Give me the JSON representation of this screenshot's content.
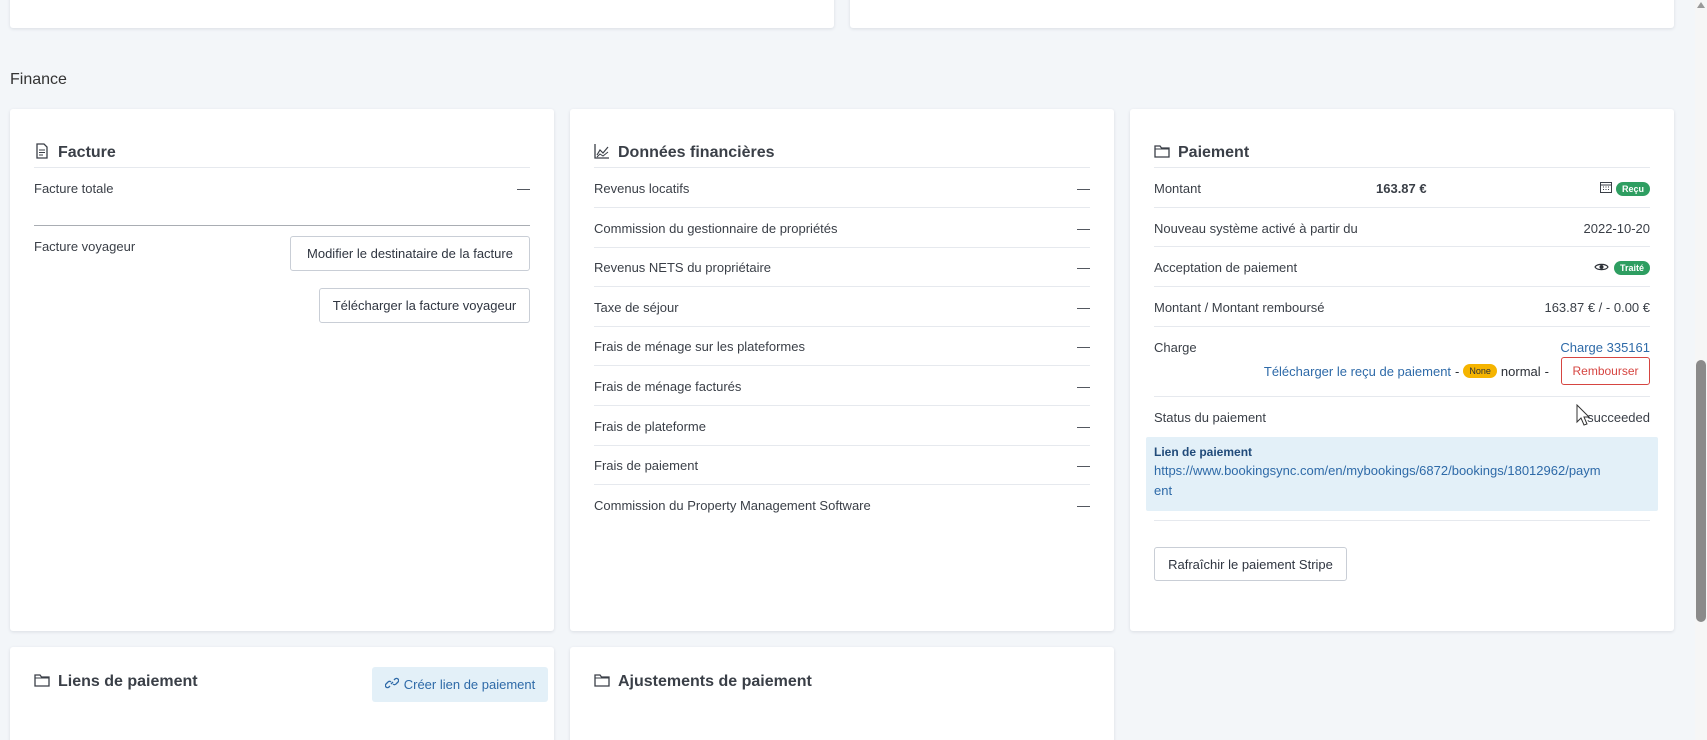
{
  "section_title": "Finance",
  "facture": {
    "title": "Facture",
    "rows": [
      {
        "label": "Facture totale",
        "value": "—"
      },
      {
        "label": "Facture voyageur"
      }
    ],
    "btn_modify": "Modifier le destinataire de la facture",
    "btn_download": "Télécharger la facture voyageur"
  },
  "donnees": {
    "title": "Données financières",
    "rows": [
      {
        "label": "Revenus locatifs",
        "value": "—"
      },
      {
        "label": "Commission du gestionnaire de propriétés",
        "value": "—"
      },
      {
        "label": "Revenus NETS du propriétaire",
        "value": "—"
      },
      {
        "label": "Taxe de séjour",
        "value": "—"
      },
      {
        "label": "Frais de ménage sur les plateformes",
        "value": "—"
      },
      {
        "label": "Frais de ménage facturés",
        "value": "—"
      },
      {
        "label": "Frais de plateforme",
        "value": "—"
      },
      {
        "label": "Frais de paiement",
        "value": "—"
      },
      {
        "label": "Commission du Property Management Software",
        "value": "—"
      }
    ]
  },
  "paiement": {
    "title": "Paiement",
    "montant_label": "Montant",
    "montant_value": "163.87 €",
    "recu_badge": "Reçu",
    "nouveau_label": "Nouveau système activé à partir du",
    "nouveau_value": "2022-10-20",
    "acceptation_label": "Acceptation de paiement",
    "traite_badge": "Traité",
    "rembourse_label": "Montant / Montant remboursé",
    "rembourse_value": "163.87 € / - 0.00 €",
    "charge_label": "Charge",
    "charge_link": "Charge 335161",
    "recu_link": "Télécharger le reçu de paiement",
    "dash1": "-",
    "none_badge": "None",
    "normal_text": "normal",
    "dash2": "-",
    "rembourser_btn": "Rembourser",
    "status_label": "Status du paiement",
    "status_value": "succeeded",
    "lien_title": "Lien de paiement",
    "lien_url_1": "https://www.bookingsync.com/en/mybookings/6872/bookings/18012962/paym",
    "lien_url_2": "ent",
    "refresh_btn": "Rafraîchir le paiement Stripe"
  },
  "liens": {
    "title": "Liens de paiement",
    "create_btn": "Créer lien de paiement"
  },
  "ajustements": {
    "title": "Ajustements de paiement"
  },
  "colors": {
    "green": "#2e9e61",
    "amber": "#f5b400",
    "red": "#d64541",
    "link": "#2e6aa8",
    "light_blue": "#e3f0f8"
  },
  "icons": [
    "document-icon",
    "chart-area-icon",
    "folder-icon",
    "calendar-icon",
    "eye-icon",
    "link-icon",
    "cursor-icon"
  ]
}
